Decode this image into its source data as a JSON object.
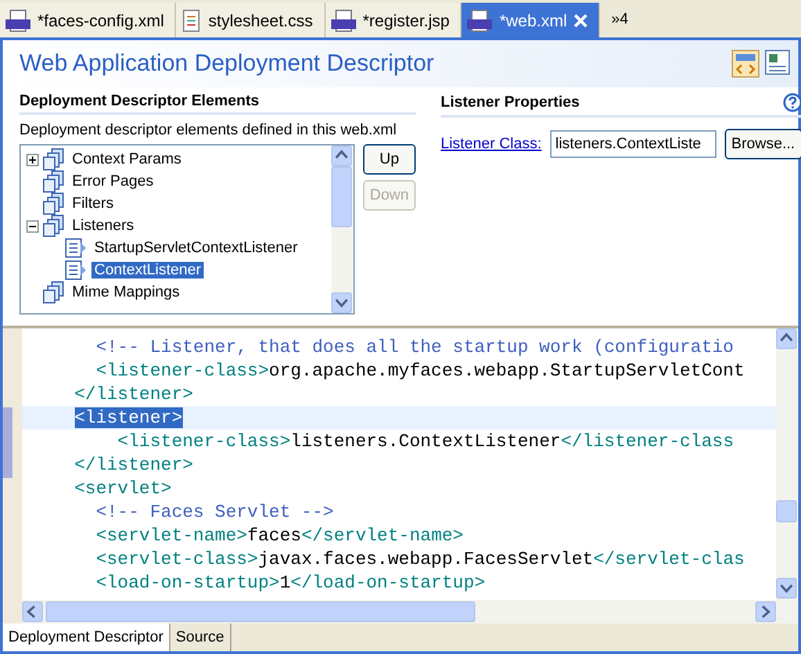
{
  "editor_tabs": [
    {
      "label": "*faces-config.xml",
      "kind": "xml",
      "selected": false
    },
    {
      "label": "stylesheet.css",
      "kind": "css",
      "selected": false
    },
    {
      "label": "*register.jsp",
      "kind": "jsp",
      "selected": false
    },
    {
      "label": "*web.xml",
      "kind": "xml",
      "selected": true
    }
  ],
  "overflow_tabs": "»4",
  "title": "Web Application Deployment Descriptor",
  "elements_section": {
    "title": "Deployment Descriptor Elements",
    "description": "Deployment descriptor elements defined in this web.xml",
    "tree": [
      {
        "label": "Context Params",
        "expanded": false
      },
      {
        "label": "Error Pages"
      },
      {
        "label": "Filters"
      },
      {
        "label": "Listeners",
        "expanded": true,
        "children": [
          {
            "label": "StartupServletContextListener",
            "selected": false
          },
          {
            "label": "ContextListener",
            "selected": true
          }
        ]
      },
      {
        "label": "Mime Mappings"
      }
    ],
    "buttons": [
      {
        "label": "Up",
        "disabled": false
      },
      {
        "label": "Down",
        "disabled": true
      }
    ]
  },
  "properties_section": {
    "title": "Listener Properties",
    "field_label": "Listener Class:",
    "field_value": "listeners.ContextListe",
    "browse_button": "Browse..."
  },
  "source_lines": [
    {
      "current": false,
      "segments": [
        {
          "kind": "comment",
          "text": "    <!-- Listener, that does all the startup work (configuratio"
        }
      ]
    },
    {
      "current": false,
      "segments": [
        {
          "kind": "tag",
          "text": "    <listener-class>"
        },
        {
          "kind": "text",
          "text": "org.apache.myfaces.webapp.StartupServletCont"
        }
      ]
    },
    {
      "current": false,
      "segments": [
        {
          "kind": "tag",
          "text": "  </listener>"
        }
      ]
    },
    {
      "current": true,
      "segments": [
        {
          "kind": "selected",
          "text": "  <listener>"
        }
      ]
    },
    {
      "current": false,
      "segments": [
        {
          "kind": "tag",
          "text": "      <listener-class>"
        },
        {
          "kind": "text",
          "text": "listeners.ContextListener"
        },
        {
          "kind": "tag",
          "text": "</listener-class"
        }
      ]
    },
    {
      "current": false,
      "segments": [
        {
          "kind": "tag",
          "text": "  </listener>"
        }
      ]
    },
    {
      "current": false,
      "segments": [
        {
          "kind": "tag",
          "text": "  <servlet>"
        }
      ]
    },
    {
      "current": false,
      "segments": [
        {
          "kind": "comment",
          "text": "    <!-- Faces Servlet -->"
        }
      ]
    },
    {
      "current": false,
      "segments": [
        {
          "kind": "tag",
          "text": "    <servlet-name>"
        },
        {
          "kind": "text",
          "text": "faces"
        },
        {
          "kind": "tag",
          "text": "</servlet-name>"
        }
      ]
    },
    {
      "current": false,
      "segments": [
        {
          "kind": "tag",
          "text": "    <servlet-class>"
        },
        {
          "kind": "text",
          "text": "javax.faces.webapp.FacesServlet"
        },
        {
          "kind": "tag",
          "text": "</servlet-clas"
        }
      ]
    },
    {
      "current": false,
      "segments": [
        {
          "kind": "tag",
          "text": "    <load-on-startup>"
        },
        {
          "kind": "text",
          "text": "1"
        },
        {
          "kind": "tag",
          "text": "</load-on-startup>"
        }
      ]
    }
  ],
  "page_tabs": [
    {
      "label": "Deployment Descriptor",
      "selected": true
    },
    {
      "label": "Source",
      "selected": false
    }
  ]
}
